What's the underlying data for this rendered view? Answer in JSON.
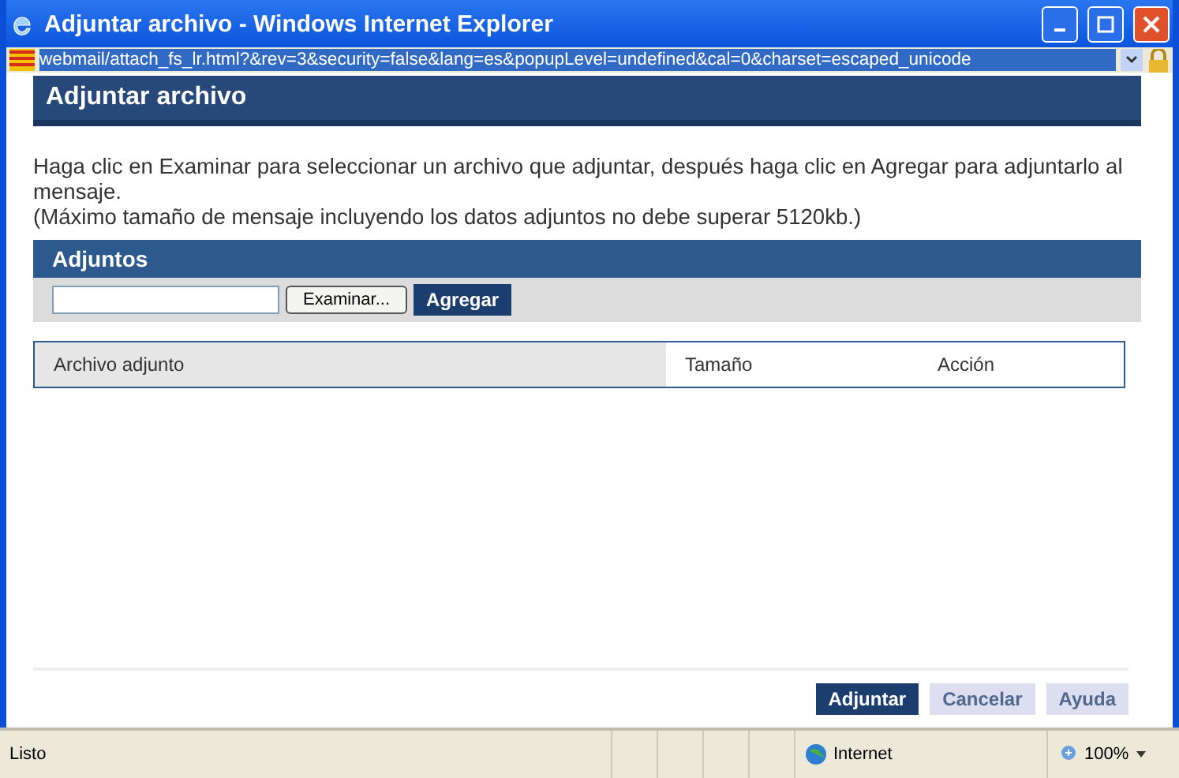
{
  "window": {
    "title": "Adjuntar archivo - Windows Internet Explorer"
  },
  "address_bar": {
    "value": "webmail/attach_fs_lr.html?&rev=3&security=false&lang=es&popupLevel=undefined&cal=0&charset=escaped_unicode"
  },
  "page": {
    "heading": "Adjuntar archivo",
    "instructions": [
      "Haga clic en Examinar para seleccionar un archivo que adjuntar, después haga clic en Agregar para adjuntarlo al mensaje.",
      "(Máximo tamaño de mensaje incluyendo los datos adjuntos no debe superar 5120kb.)"
    ],
    "attachments": {
      "title": "Adjuntos",
      "browse_button": "Examinar...",
      "add_button": "Agregar",
      "columns": [
        "Archivo adjunto",
        "Tamaño",
        "Acción"
      ]
    },
    "buttons": [
      {
        "label": "Adjuntar",
        "primary": true
      },
      {
        "label": "Cancelar",
        "primary": false
      },
      {
        "label": "Ayuda",
        "primary": false
      }
    ]
  },
  "status_bar": {
    "text": "Listo",
    "zone": "Internet",
    "zoom": "100%"
  }
}
